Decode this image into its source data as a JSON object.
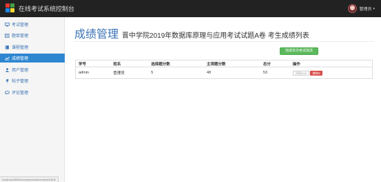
{
  "app": {
    "title": "在线考试系统控制台",
    "user_name": "管理员"
  },
  "sidebar": {
    "items": [
      {
        "label": "考试管理",
        "icon": "monitor-icon",
        "active": false
      },
      {
        "label": "题目管理",
        "icon": "list-icon",
        "active": false
      },
      {
        "label": "课程管理",
        "icon": "book-icon",
        "active": false
      },
      {
        "label": "成绩管理",
        "icon": "chart-icon",
        "active": true
      },
      {
        "label": "用户管理",
        "icon": "user-icon",
        "active": false
      },
      {
        "label": "帖子管理",
        "icon": "pin-icon",
        "active": false
      },
      {
        "label": "评论管理",
        "icon": "comment-icon",
        "active": false
      }
    ]
  },
  "page": {
    "title": "成绩管理",
    "subtitle": "晋中学院2019年数据库原理与应用考试试题A卷  考生成绩列表",
    "finish_button": "完成本次考试批改"
  },
  "table": {
    "headers": [
      "学号",
      "姓名",
      "选择题分数",
      "主观题分数",
      "总分",
      "操作"
    ],
    "rows": [
      {
        "id": "admin",
        "name": "管理员",
        "choice_score": "5",
        "subjective_score": "48",
        "total": "53",
        "edit_label": "评阅/Edit",
        "delete_label": "删除ill"
      }
    ]
  },
  "status_bar": {
    "text": "localhost:8080/onexam/result/content/4/Edit"
  },
  "colors": {
    "accent": "#2e86d1",
    "success": "#5cb85c",
    "danger": "#d9534f",
    "topbar": "#222222"
  }
}
